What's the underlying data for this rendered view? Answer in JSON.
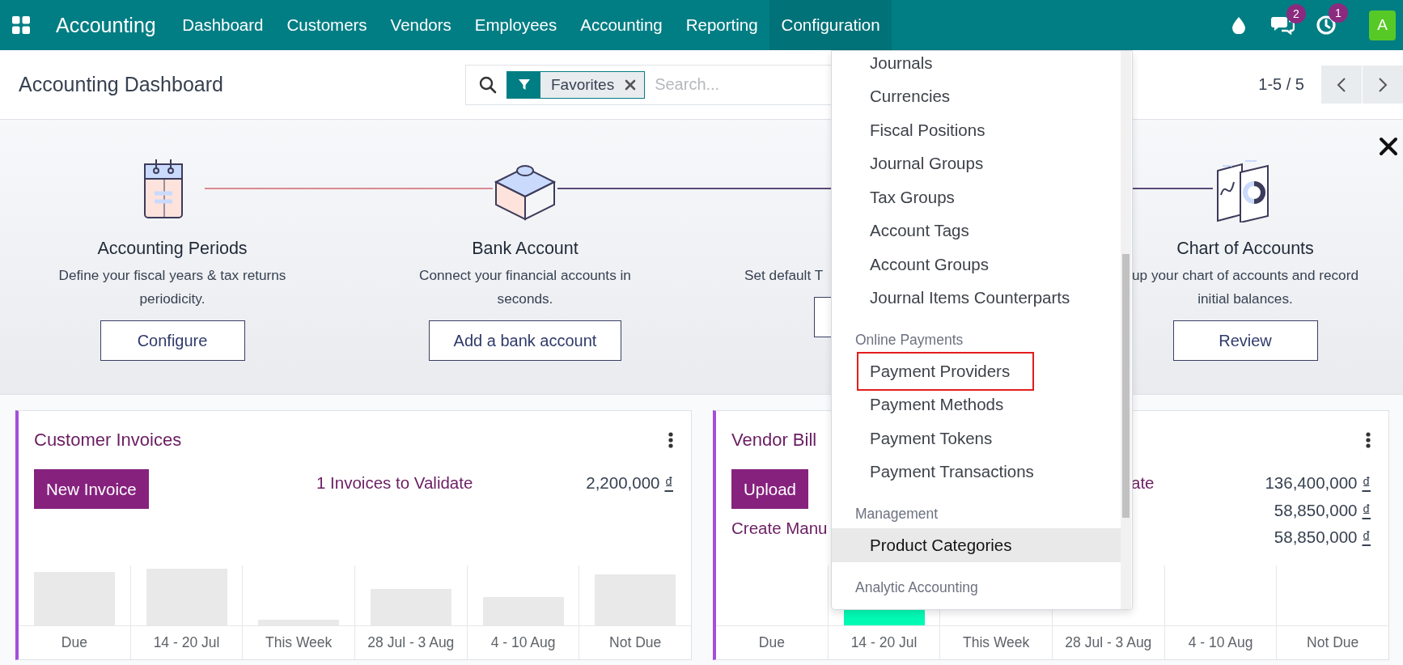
{
  "navbar": {
    "app_name": "Accounting",
    "menu": [
      {
        "label": "Dashboard",
        "selected": false
      },
      {
        "label": "Customers",
        "selected": false
      },
      {
        "label": "Vendors",
        "selected": false
      },
      {
        "label": "Employees",
        "selected": false
      },
      {
        "label": "Accounting",
        "selected": false
      },
      {
        "label": "Reporting",
        "selected": false
      },
      {
        "label": "Configuration",
        "selected": true
      }
    ],
    "notifications": [
      {
        "kind": "chat",
        "count": "2"
      },
      {
        "kind": "activity",
        "count": "1"
      }
    ],
    "avatar": "A"
  },
  "control_panel": {
    "title": "Accounting Dashboard",
    "search": {
      "facets": [
        {
          "label": "Favorites"
        }
      ],
      "placeholder": "Search..."
    },
    "pager": "1-5 / 5"
  },
  "onboarding": {
    "steps": [
      {
        "kind": "full",
        "title": "Accounting Periods",
        "description": [
          "Define your fiscal years & tax returns",
          "periodicity."
        ],
        "button": "Configure"
      },
      {
        "kind": "full",
        "title": "Bank Account",
        "description": [
          "Connect your financial accounts in",
          "seconds."
        ],
        "button": "Add a bank account"
      },
      {
        "kind": "covered_right",
        "description": [
          "Set default T"
        ]
      },
      {
        "kind": "covered_left",
        "title": "Chart of Accounts",
        "description": [
          "up your chart of accounts and record",
          "initial balances."
        ],
        "button": "Review"
      }
    ]
  },
  "journals": [
    {
      "title": "Customer Invoices",
      "button": "New Invoice",
      "link": "1 Invoices to Validate",
      "amounts": [
        {
          "value": "2,200,000",
          "currency": "₫"
        }
      ],
      "chart_labels": [
        "Due",
        "14 - 20 Jul",
        "This Week",
        "28 Jul - 3 Aug",
        "4 - 10 Aug",
        "Not Due"
      ]
    },
    {
      "title": "Vendor Bill",
      "button": "Upload",
      "side_link": "Create Manu",
      "link": "ate",
      "amounts": [
        {
          "value": "136,400,000",
          "currency": "₫"
        },
        {
          "value": "58,850,000",
          "currency": "₫"
        },
        {
          "value": "58,850,000",
          "currency": "₫"
        }
      ],
      "chart_labels": [
        "Due",
        "14 - 20 Jul",
        "This Week",
        "28 Jul - 3 Aug",
        "4 - 10 Aug",
        "Not Due"
      ]
    }
  ],
  "dropdown": {
    "items": [
      {
        "kind": "item",
        "label": "Journals",
        "hovered": false,
        "marked": false
      },
      {
        "kind": "item",
        "label": "Currencies",
        "hovered": false,
        "marked": false
      },
      {
        "kind": "item",
        "label": "Fiscal Positions",
        "hovered": false,
        "marked": false
      },
      {
        "kind": "item",
        "label": "Journal Groups",
        "hovered": false,
        "marked": false
      },
      {
        "kind": "item",
        "label": "Tax Groups",
        "hovered": false,
        "marked": false
      },
      {
        "kind": "item",
        "label": "Account Tags",
        "hovered": false,
        "marked": false
      },
      {
        "kind": "item",
        "label": "Account Groups",
        "hovered": false,
        "marked": false
      },
      {
        "kind": "item",
        "label": "Journal Items Counterparts",
        "hovered": false,
        "marked": false
      },
      {
        "kind": "header",
        "label": "Online Payments"
      },
      {
        "kind": "item",
        "label": "Payment Providers",
        "hovered": false,
        "marked": true
      },
      {
        "kind": "item",
        "label": "Payment Methods",
        "hovered": false,
        "marked": false
      },
      {
        "kind": "item",
        "label": "Payment Tokens",
        "hovered": false,
        "marked": false
      },
      {
        "kind": "item",
        "label": "Payment Transactions",
        "hovered": false,
        "marked": false
      },
      {
        "kind": "header",
        "label": "Management"
      },
      {
        "kind": "item",
        "label": "Product Categories",
        "hovered": true,
        "marked": false
      },
      {
        "kind": "header",
        "label": "Analytic Accounting"
      }
    ]
  }
}
